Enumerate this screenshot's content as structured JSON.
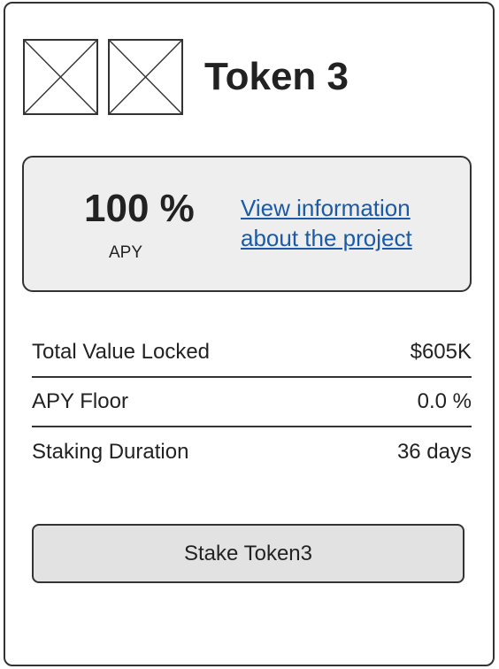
{
  "header": {
    "title": "Token 3",
    "images": [
      "image-placeholder-icon",
      "image-placeholder-icon"
    ]
  },
  "info": {
    "apy_value": "100 %",
    "apy_label": "APY",
    "link_text": "View information about the project"
  },
  "stats": [
    {
      "label": "Total Value Locked",
      "value": "$605K"
    },
    {
      "label": "APY Floor",
      "value": "0.0 %"
    },
    {
      "label": "Staking Duration",
      "value": "36 days"
    }
  ],
  "action": {
    "stake_label": "Stake Token3"
  },
  "colors": {
    "border": "#333333",
    "panel": "#eeeeee",
    "button": "#e2e2e2",
    "link": "#1a5aa6"
  }
}
